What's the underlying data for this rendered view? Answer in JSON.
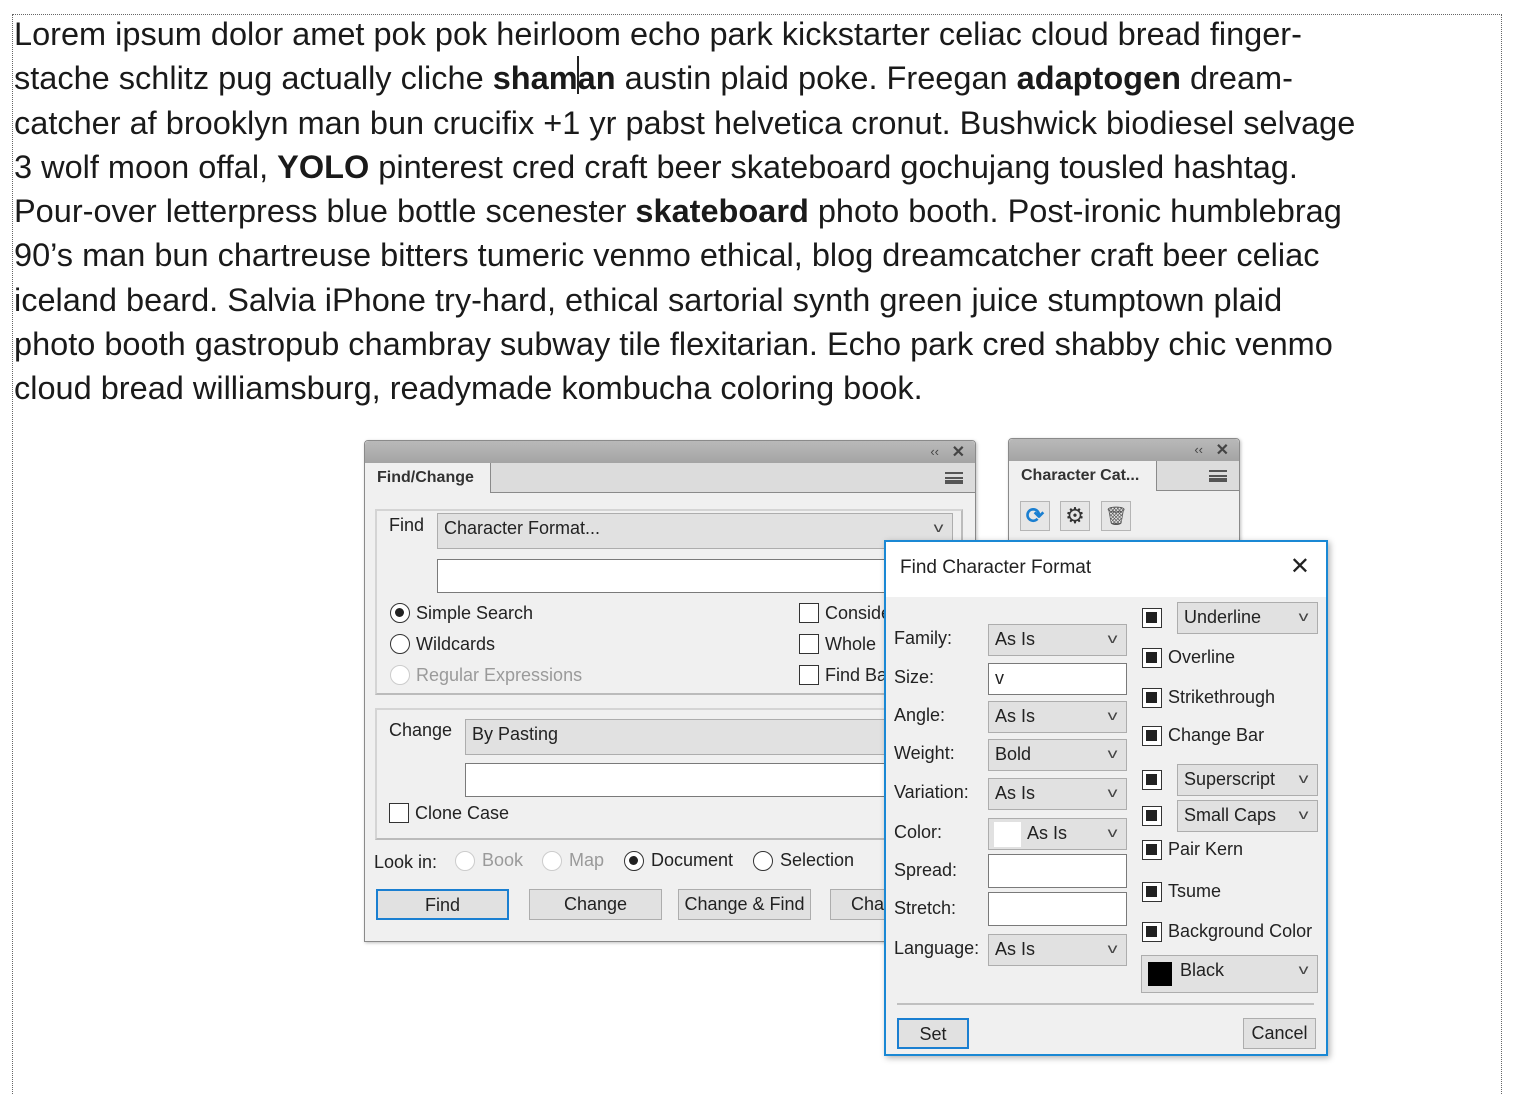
{
  "document": {
    "lines": [
      [
        {
          "t": "Lorem ipsum dolor amet pok pok heirloom echo park kickstarter celiac cloud bread finger-"
        }
      ],
      [
        {
          "t": "stache schlitz pug actually cliche "
        },
        {
          "t": "shaman",
          "b": true
        },
        {
          "t": " austin plaid poke. Freegan "
        },
        {
          "t": "adaptogen",
          "b": true
        },
        {
          "t": " dream-"
        }
      ],
      [
        {
          "t": "catcher af brooklyn man bun crucifix +1 yr pabst helvetica cronut. Bushwick biodiesel selvage"
        }
      ],
      [
        {
          "t": "3 wolf moon offal, "
        },
        {
          "t": "YOLO",
          "b": true
        },
        {
          "t": " pinterest cred craft beer skateboard gochujang tousled hashtag."
        }
      ],
      [
        {
          "t": "Pour-over letterpress blue bottle scenester "
        },
        {
          "t": "skateboard",
          "b": true
        },
        {
          "t": " photo booth. Post-ironic humblebrag"
        }
      ],
      [
        {
          "t": "90’s man bun chartreuse bitters tumeric venmo ethical, blog dreamcatcher craft beer celiac"
        }
      ],
      [
        {
          "t": "iceland beard. Salvia iPhone try-hard, ethical sartorial synth green juice stumptown plaid"
        }
      ],
      [
        {
          "t": "photo booth gastropub chambray subway tile flexitarian. Echo park cred shabby chic venmo"
        }
      ],
      [
        {
          "t": "cloud bread williamsburg, readymade kombucha coloring book."
        }
      ]
    ]
  },
  "find_change": {
    "tab": "Find/Change",
    "find_label": "Find",
    "find_value": "Character Format...",
    "find_text": "",
    "modes": [
      {
        "label": "Simple Search",
        "selected": true,
        "disabled": false
      },
      {
        "label": "Wildcards",
        "selected": false,
        "disabled": false
      },
      {
        "label": "Regular Expressions",
        "selected": false,
        "disabled": true
      }
    ],
    "options": [
      "Conside",
      "Whole",
      "Find Ba"
    ],
    "change_label": "Change",
    "change_value": "By Pasting",
    "change_text": "",
    "clone_case": "Clone Case",
    "look_in_label": "Look in:",
    "look_in": [
      {
        "label": "Book",
        "selected": false,
        "disabled": true
      },
      {
        "label": "Map",
        "selected": false,
        "disabled": true
      },
      {
        "label": "Document",
        "selected": true,
        "disabled": false
      },
      {
        "label": "Selection",
        "selected": false,
        "disabled": false
      }
    ],
    "buttons": [
      "Find",
      "Change",
      "Change & Find",
      "Cha"
    ]
  },
  "character_catalog": {
    "tab": "Character Cat...",
    "icons": [
      "refresh-icon",
      "gear-icon",
      "delete-icon"
    ]
  },
  "dialog": {
    "title": "Find Character Format",
    "fields": [
      {
        "label": "Family:",
        "value": "As Is",
        "type": "select"
      },
      {
        "label": "Size:",
        "value": "",
        "type": "combo"
      },
      {
        "label": "Angle:",
        "value": "As Is",
        "type": "select"
      },
      {
        "label": "Weight:",
        "value": "Bold",
        "type": "select"
      },
      {
        "label": "Variation:",
        "value": "As Is",
        "type": "select"
      },
      {
        "label": "Color:",
        "value": "As Is",
        "type": "color"
      },
      {
        "label": "Spread:",
        "value": "",
        "type": "text"
      },
      {
        "label": "Stretch:",
        "value": "",
        "type": "text"
      },
      {
        "label": "Language:",
        "value": "As Is",
        "type": "select"
      }
    ],
    "right": [
      {
        "label": "Underline",
        "select": true
      },
      {
        "label": "Overline",
        "select": false
      },
      {
        "label": "Strikethrough",
        "select": false
      },
      {
        "label": "Change Bar",
        "select": false
      },
      {
        "label": "Superscript",
        "select": true
      },
      {
        "label": "Small Caps",
        "select": true
      },
      {
        "label": "Pair Kern",
        "select": false
      },
      {
        "label": "Tsume",
        "select": false
      },
      {
        "label": "Background Color",
        "select": false
      }
    ],
    "background_color": "Black",
    "set": "Set",
    "cancel": "Cancel",
    "accent": "#1a88d4"
  }
}
